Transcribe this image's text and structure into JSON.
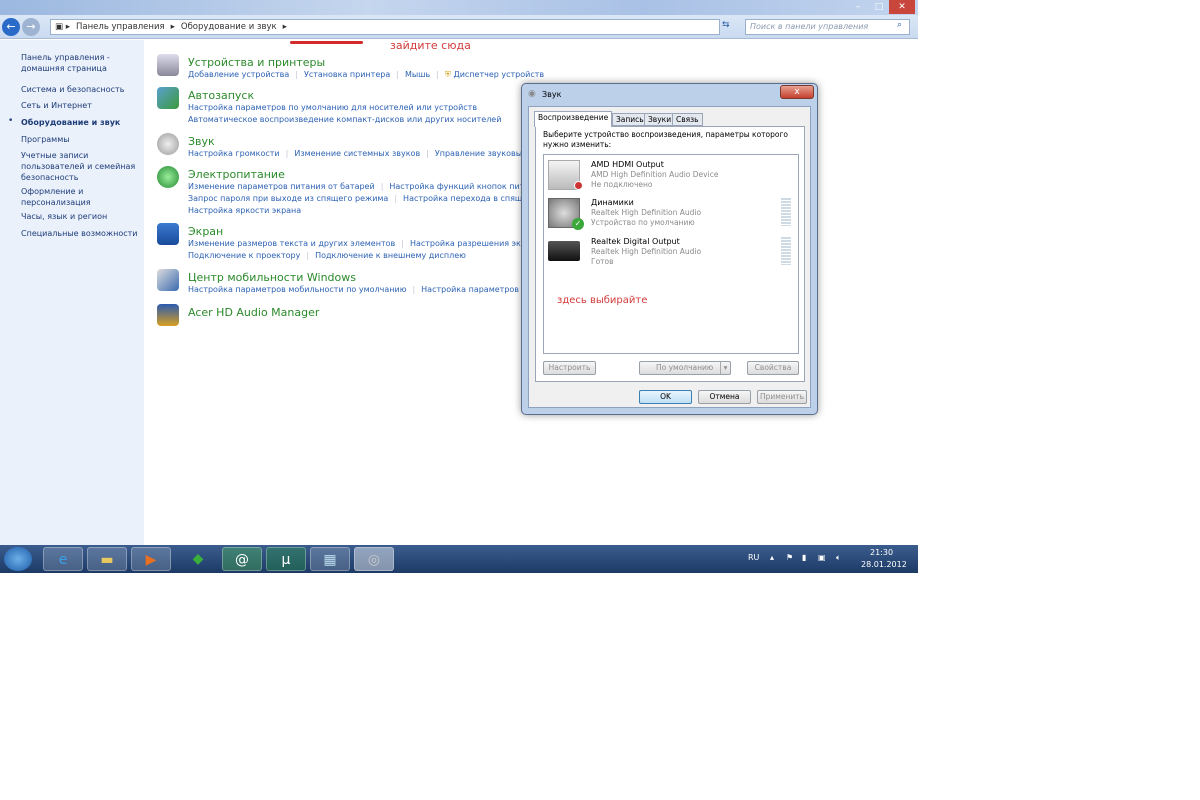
{
  "window": {
    "breadcrumb": [
      "Панель управления",
      "Оборудование и звук"
    ],
    "search_placeholder": "Поиск в панели управления",
    "annotation_top": "зайдите сюда"
  },
  "sidebar": {
    "items": [
      {
        "label": "Панель управления - домашняя страница"
      },
      {
        "label": "Система и безопасность"
      },
      {
        "label": "Сеть и Интернет"
      },
      {
        "label": "Оборудование и звук",
        "active": true
      },
      {
        "label": "Программы"
      },
      {
        "label": "Учетные записи пользователей и семейная безопасность"
      },
      {
        "label": "Оформление и персонализация"
      },
      {
        "label": "Часы, язык и регион"
      },
      {
        "label": "Специальные возможности"
      }
    ]
  },
  "categories": [
    {
      "title": "Устройства и принтеры",
      "links": [
        [
          "Добавление устройства",
          "Установка принтера",
          "Мышь",
          "Диспетчер устройств"
        ]
      ]
    },
    {
      "title": "Автозапуск",
      "links": [
        [
          "Настройка параметров по умолчанию для носителей или устройств"
        ],
        [
          "Автоматическое воспроизведение компакт-дисков или других носителей"
        ]
      ]
    },
    {
      "title": "Звук",
      "links": [
        [
          "Настройка громкости",
          "Изменение системных звуков",
          "Управление звуковыми у"
        ]
      ]
    },
    {
      "title": "Электропитание",
      "links": [
        [
          "Изменение параметров питания от батарей",
          "Настройка функций кнопок питания"
        ],
        [
          "Запрос пароля при выходе из спящего режима",
          "Настройка перехода в спящий ре"
        ],
        [
          "Настройка яркости экрана"
        ]
      ]
    },
    {
      "title": "Экран",
      "links": [
        [
          "Изменение размеров текста и других элементов",
          "Настройка разрешения экрана"
        ],
        [
          "Подключение к проектору",
          "Подключение к внешнему дисплею"
        ]
      ]
    },
    {
      "title": "Центр мобильности Windows",
      "links": [
        [
          "Настройка параметров мобильности по умолчанию",
          "Настройка параметров пре"
        ]
      ]
    },
    {
      "title": "Acer HD Audio Manager",
      "links": []
    }
  ],
  "dialog": {
    "title": "Звук",
    "close": "x",
    "tabs": [
      "Воспроизведение",
      "Запись",
      "Звуки",
      "Связь"
    ],
    "instruction": "Выберите устройство воспроизведения, параметры которого нужно изменить:",
    "devices": [
      {
        "name": "AMD HDMI Output",
        "driver": "AMD High Definition Audio Device",
        "status": "Не подключено"
      },
      {
        "name": "Динамики",
        "driver": "Realtek High Definition Audio",
        "status": "Устройство по умолчанию"
      },
      {
        "name": "Realtek Digital Output",
        "driver": "Realtek High Definition Audio",
        "status": "Готов"
      }
    ],
    "annotation": "здесь выбирайте",
    "buttons": {
      "configure": "Настроить",
      "default": "По умолчанию",
      "properties": "Свойства",
      "ok": "OK",
      "cancel": "Отмена",
      "apply": "Применить"
    }
  },
  "taskbar": {
    "lang": "RU",
    "time": "21:30",
    "date": "28.01.2012"
  }
}
